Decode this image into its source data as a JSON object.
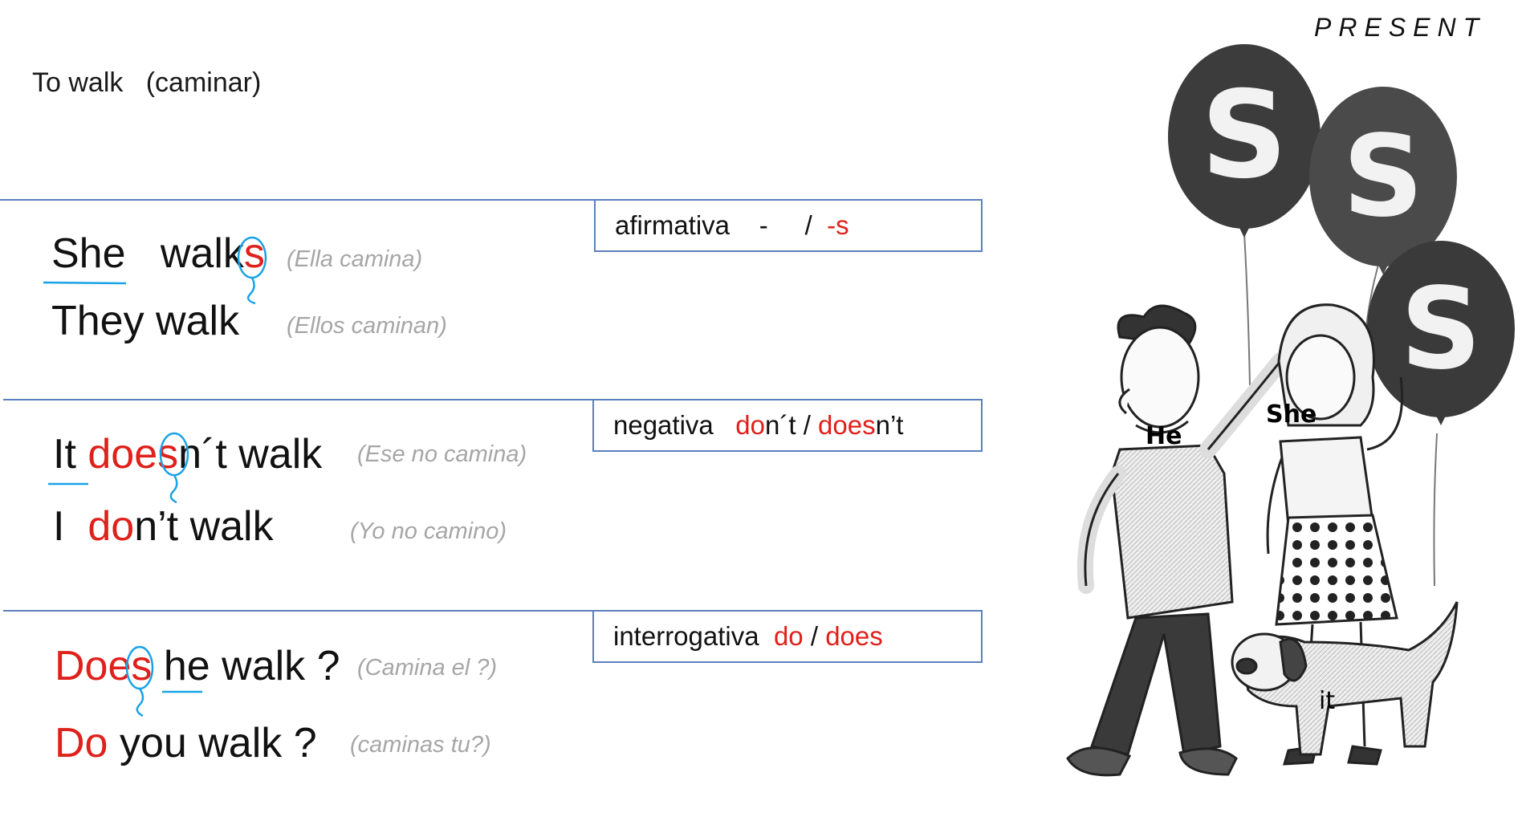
{
  "title": {
    "verb": "To walk",
    "translation": "(caminar)"
  },
  "header": {
    "tense": "PRESENT"
  },
  "boxes": {
    "affirmative": {
      "label": "afirmativa",
      "dash": "-",
      "slash": "/",
      "suffix": "-s"
    },
    "negative": {
      "label": "negativa",
      "do_part": "do",
      "do_rest": "n´t",
      "slash": "/",
      "does_part": "does",
      "does_rest": "n’t"
    },
    "interrogative": {
      "label": "interrogativa",
      "do": "do",
      "slash": "/",
      "does": "does"
    }
  },
  "sentences": {
    "s1": {
      "pronoun": "She",
      "verb_stem": "walk",
      "verb_suffix": "s",
      "gloss": "(Ella  camina)"
    },
    "s2": {
      "text": "They walk",
      "gloss": "(Ellos  caminan)"
    },
    "s3": {
      "pronoun": "It",
      "aux": "does",
      "rest": "n´t walk",
      "gloss": "(Ese no camina)"
    },
    "s4": {
      "pronoun": "I",
      "aux": "do",
      "rest": "n’t walk",
      "gloss": "(Yo no camino)"
    },
    "s5": {
      "aux": "Does",
      "rest": "he walk ?",
      "gloss": "(Camina el ?)"
    },
    "s6": {
      "aux": "Do",
      "rest": "you walk ?",
      "gloss": "(caminas tu?)"
    }
  },
  "illustration": {
    "balloons": [
      "S",
      "S",
      "S"
    ],
    "labels": {
      "he": "He",
      "she": "She",
      "it": "it"
    }
  },
  "colors": {
    "accent_red": "#e0201b",
    "label_blue": "#1aa3e6",
    "rule_blue": "#5b7fbe",
    "gloss_grey": "#a6a6a6"
  }
}
